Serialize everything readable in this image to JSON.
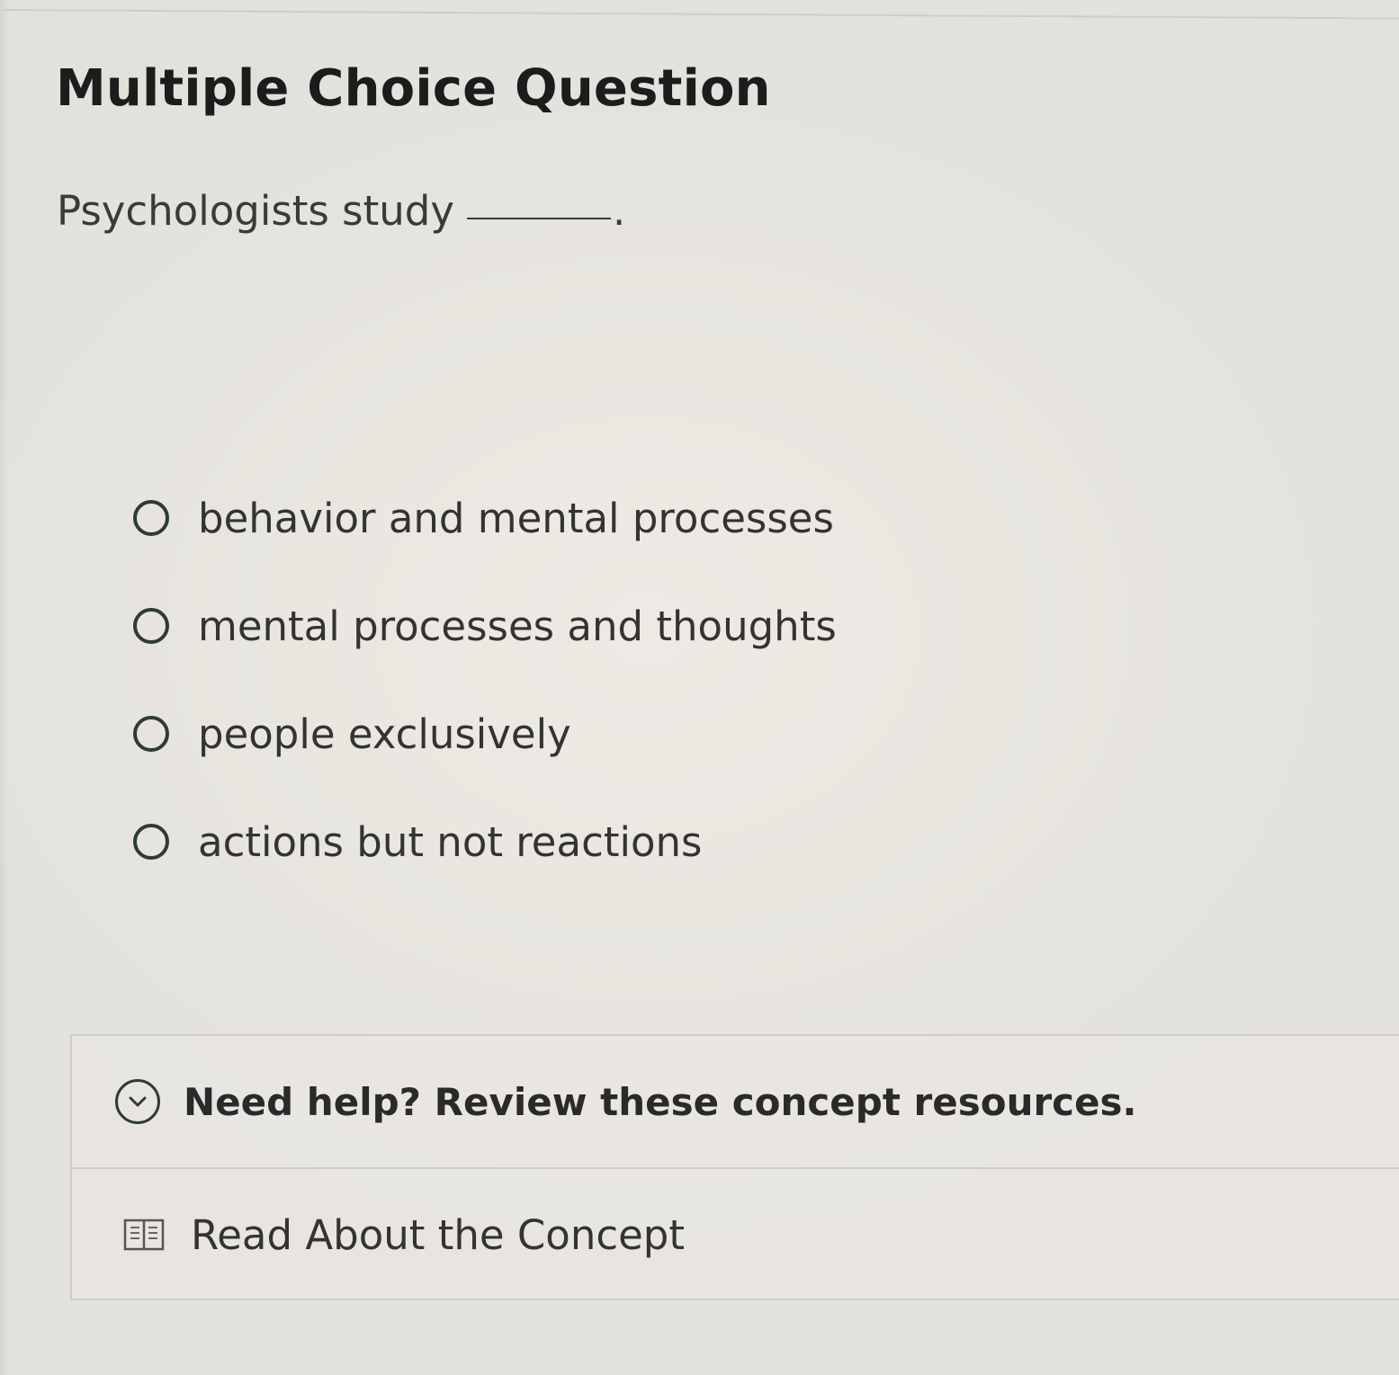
{
  "question": {
    "heading": "Multiple Choice Question",
    "prompt": "Psychologists study",
    "prompt_end": "."
  },
  "options": [
    {
      "label": "behavior and mental processes"
    },
    {
      "label": "mental processes and thoughts"
    },
    {
      "label": "people exclusively"
    },
    {
      "label": "actions but not reactions"
    }
  ],
  "help": {
    "title": "Need help? Review these concept resources.",
    "resources": [
      {
        "label": "Read About the Concept",
        "icon": "book-icon"
      }
    ]
  },
  "colors": {
    "radio_border": "#2f3a36",
    "text": "#333333"
  }
}
